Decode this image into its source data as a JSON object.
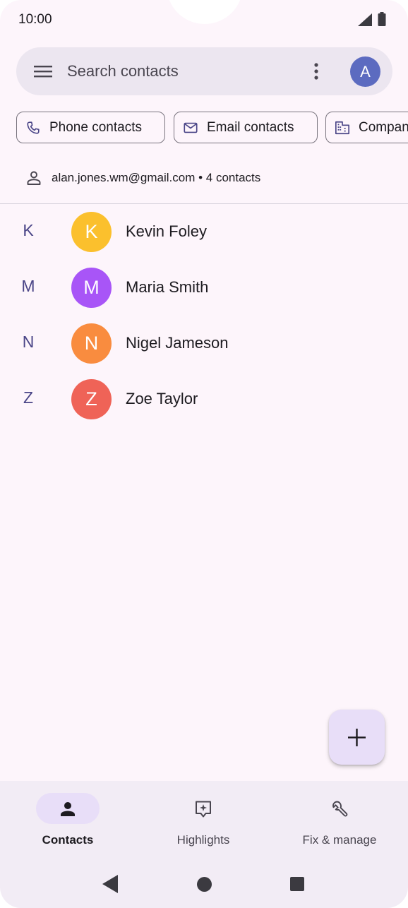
{
  "status_bar": {
    "time": "10:00",
    "signal_icon": "cell-signal-icon",
    "battery_icon": "battery-icon"
  },
  "search": {
    "placeholder": "Search contacts",
    "account_initial": "A",
    "account_color": "#5c6bc0",
    "menu_icon": "hamburger-menu-icon",
    "more_icon": "more-vert-icon"
  },
  "chips": [
    {
      "label": "Phone contacts",
      "icon": "phone-icon"
    },
    {
      "label": "Email contacts",
      "icon": "mail-icon"
    },
    {
      "label": "Compan",
      "icon": "business-icon"
    }
  ],
  "account": {
    "text": "alan.jones.wm@gmail.com • 4 contacts",
    "icon": "person-outline-icon"
  },
  "contacts": [
    {
      "section": "K",
      "initial": "K",
      "name": "Kevin Foley",
      "color": "#fbc02d"
    },
    {
      "section": "M",
      "initial": "M",
      "name": "Maria Smith",
      "color": "#a855f7"
    },
    {
      "section": "N",
      "initial": "N",
      "name": "Nigel Jameson",
      "color": "#f98c3f"
    },
    {
      "section": "Z",
      "initial": "Z",
      "name": "Zoe Taylor",
      "color": "#ef6357"
    }
  ],
  "fab": {
    "icon": "plus-icon"
  },
  "bottom_nav": [
    {
      "label": "Contacts",
      "icon": "person-icon",
      "active": true
    },
    {
      "label": "Highlights",
      "icon": "highlights-icon",
      "active": false
    },
    {
      "label": "Fix & manage",
      "icon": "wrench-icon",
      "active": false
    }
  ],
  "colors": {
    "background": "#fdf5fb",
    "accent_container": "#e8def8",
    "section_letter": "#4a4587"
  }
}
